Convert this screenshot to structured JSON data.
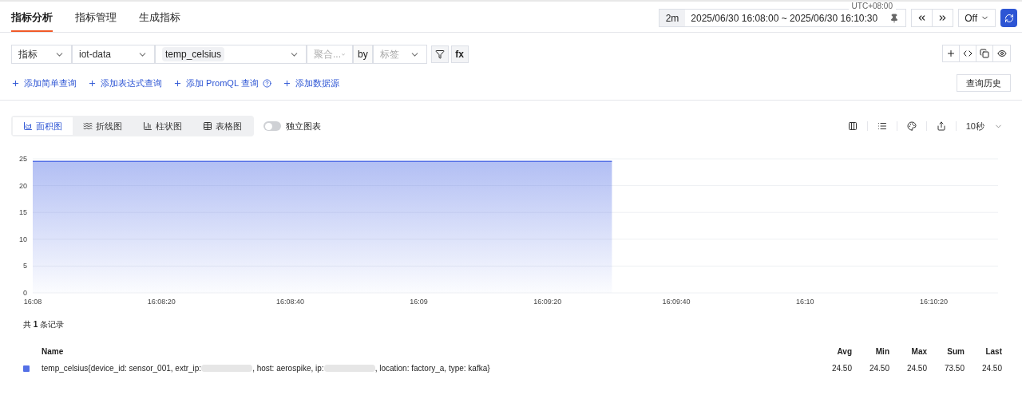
{
  "tabs": [
    {
      "label": "指标分析",
      "selected": true
    },
    {
      "label": "指标管理",
      "selected": false
    },
    {
      "label": "生成指标",
      "selected": false
    }
  ],
  "time_range": {
    "timezone": "UTC+08:00",
    "preset": "2m",
    "range": "2025/06/30 16:08:00 ~ 2025/06/30 16:10:30",
    "refresh": "Off"
  },
  "query": {
    "type": "指标",
    "source": "iot-data",
    "metric": "temp_celsius",
    "aggregate_placeholder": "聚合...",
    "by": "by",
    "label_placeholder": "标签",
    "fx": "fx"
  },
  "add_links": [
    {
      "label": "添加简单查询",
      "help": false
    },
    {
      "label": "添加表达式查询",
      "help": false
    },
    {
      "label": "添加 PromQL 查询",
      "help": true
    },
    {
      "label": "添加数据源",
      "help": false
    }
  ],
  "history_button": "查询历史",
  "chart_types": [
    {
      "label": "面积图",
      "kind": "area",
      "selected": true
    },
    {
      "label": "折线图",
      "kind": "line",
      "selected": false
    },
    {
      "label": "柱状图",
      "kind": "bar",
      "selected": false
    },
    {
      "label": "表格图",
      "kind": "table",
      "selected": false
    }
  ],
  "independent_chart": {
    "label": "独立图表",
    "on": false
  },
  "interval": "10秒",
  "chart": {
    "chart_data": {
      "type": "area",
      "categories": [
        "16:08",
        null,
        "16:08:20",
        null,
        "16:08:40",
        null,
        "16:09",
        null,
        "16:09:20",
        null,
        "16:09:40",
        null,
        "16:10",
        null,
        "16:10:20",
        null
      ],
      "ylim": [
        0,
        25
      ],
      "grid": true,
      "yticks": [
        0,
        5,
        10,
        15,
        20,
        25
      ],
      "series": [
        {
          "color": "#5470e6",
          "values": [
            24.5,
            24.5,
            24.5,
            24.5,
            24.5,
            24.5,
            24.5,
            24.5,
            24.5,
            24.5,
            null,
            null,
            null,
            null,
            null,
            null
          ]
        }
      ]
    }
  },
  "record_count": "共 **1** 条记录",
  "legend": {
    "columns": [
      "Name",
      "Avg",
      "Min",
      "Max",
      "Sum",
      "Last"
    ],
    "rows": [
      {
        "color": "#5470e6",
        "name": [
          {
            "kind": "text",
            "text": "temp_celsius{device_id: sensor_001, extr_ip: "
          },
          {
            "kind": "redacted"
          },
          {
            "kind": "text",
            "text": ", host: aerospike, ip: "
          },
          {
            "kind": "redacted"
          },
          {
            "kind": "text",
            "text": ", location: factory_a, type: kafka}"
          }
        ],
        "values": [
          "24.50",
          "24.50",
          "24.50",
          "73.50",
          "24.50"
        ]
      }
    ]
  }
}
